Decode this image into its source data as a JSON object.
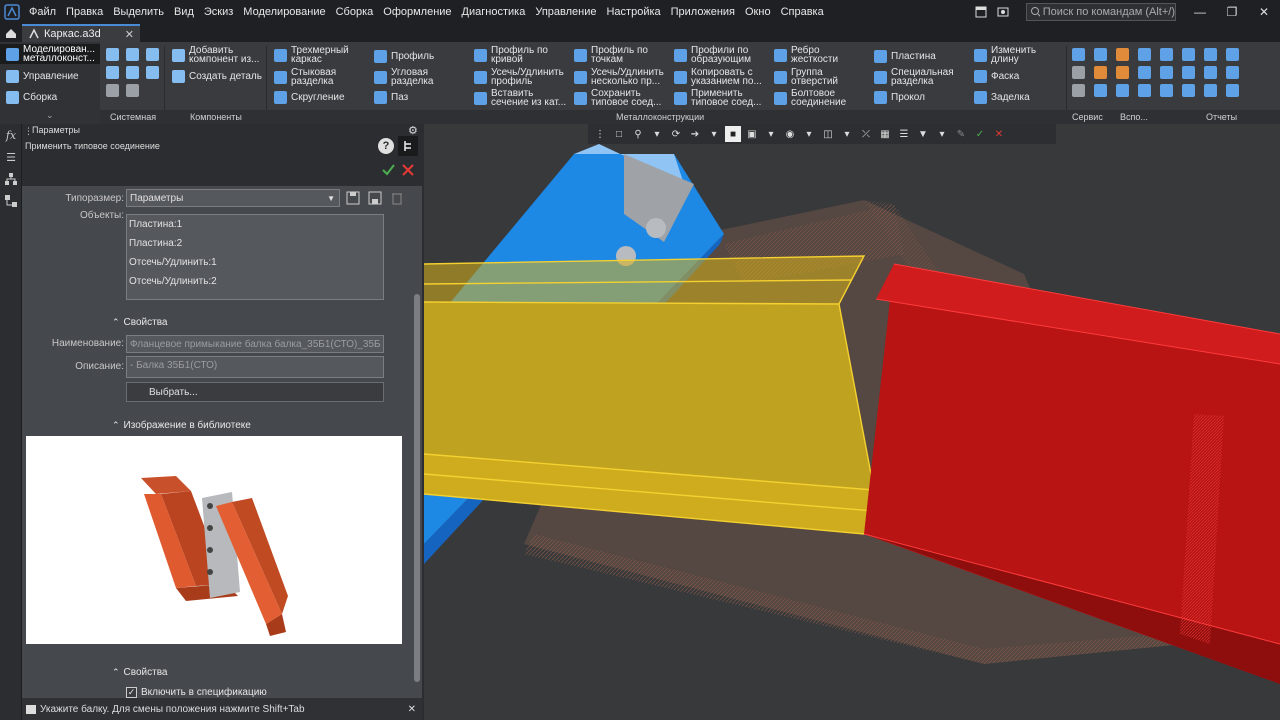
{
  "menubar": {
    "items": [
      "Файл",
      "Правка",
      "Выделить",
      "Вид",
      "Эскиз",
      "Моделирование",
      "Сборка",
      "Оформление",
      "Диагностика",
      "Управление",
      "Настройка",
      "Приложения",
      "Окно",
      "Справка"
    ],
    "search_placeholder": "Поиск по командам (Alt+/)"
  },
  "tabbar": {
    "document_tab": "Каркас.a3d"
  },
  "ribbon": {
    "left_tabs": [
      {
        "label": "Моделирован... металлоконст..."
      },
      {
        "label": "Управление"
      },
      {
        "label": "Сборка"
      }
    ],
    "items": [
      "Добавить компонент из...",
      "Создать деталь",
      "Трехмерный каркас",
      "Стыковая разделка",
      "Скругление",
      "Профиль",
      "Угловая разделка",
      "Паз",
      "Профиль по кривой",
      "Усечь/Удлинить профиль",
      "Вставить сечение из кат...",
      "Профиль по точкам",
      "Усечь/Удлинить несколько пр...",
      "Сохранить типовое соед...",
      "Профили по образующим",
      "Копировать с указанием по...",
      "Применить типовое соед...",
      "Ребро жесткости",
      "Группа отверстий",
      "Болтовое соединение",
      "Пластина",
      "Специальная разделка",
      "Прокол",
      "Изменить длину",
      "Фаска",
      "Заделка"
    ],
    "groups": [
      "Системная",
      "Компоненты",
      "Металлоконструкции",
      "Сервис",
      "Вспо...",
      "Отчеты"
    ]
  },
  "panel": {
    "title": "Параметры",
    "subtitle": "Применить типовое соединение",
    "typesize_label": "Типоразмер:",
    "typesize_value": "Параметры",
    "objects_label": "Объекты:",
    "objects": [
      "Пластина:1",
      "Пластина:2",
      "Отсечь/Удлинить:1",
      "Отсечь/Удлинить:2"
    ],
    "section_properties": "Свойства",
    "name_label": "Наименование:",
    "name_value": "Фланцевое примыкание  балка балка_35Б1(СТО)_35Б",
    "desc_label": "Описание:",
    "desc_value": "- Балка 35Б1(СТО)",
    "choose_button": "Выбрать...",
    "section_image": "Изображение в библиотеке",
    "section_properties2": "Свойства",
    "include_spec": "Включить в спецификацию"
  },
  "status": {
    "hint": "Укажите балку. Для смены положения нажмите Shift+Tab"
  },
  "colors": {
    "accent": "#4b8bd6",
    "ok": "#4caf50",
    "cancel": "#e53935",
    "beam_blue": "#1e88e5",
    "beam_yellow": "#e6c02a",
    "beam_red": "#c91818"
  }
}
